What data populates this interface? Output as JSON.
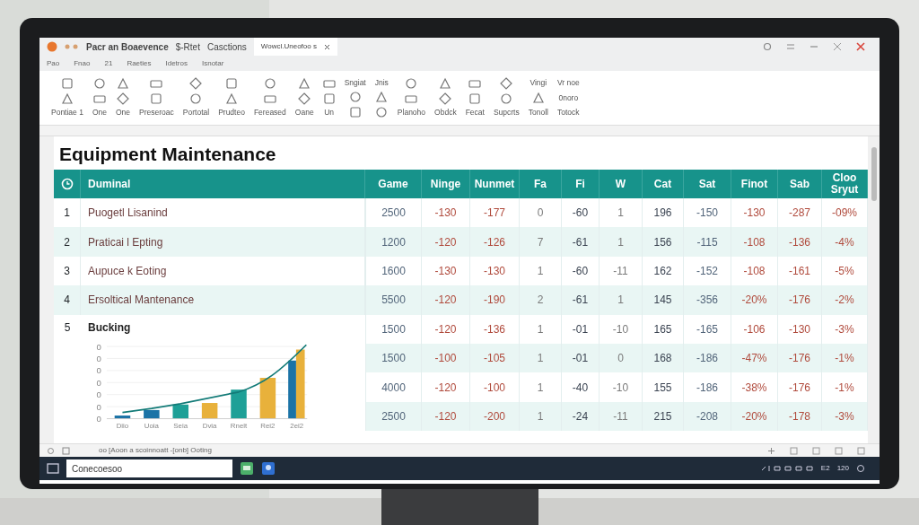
{
  "window": {
    "title": "Pacr an Boaevence",
    "title_extras": [
      "$-Rtet",
      "Casctions"
    ],
    "tab": {
      "label": "Wowcl.Uneofoo s",
      "selected": true
    }
  },
  "menu": [
    "Pao",
    "Fnao",
    "21",
    "Raeties",
    "Idetros",
    "Isnotar"
  ],
  "ribbon": [
    {
      "label": "Pontiae 1"
    },
    {
      "label": "One"
    },
    {
      "label": "One"
    },
    {
      "label": "Preseroac"
    },
    {
      "label": "Portotal"
    },
    {
      "label": "Prudteo"
    },
    {
      "label": "Fereased"
    },
    {
      "label": "Oane"
    },
    {
      "label": "Un"
    },
    {
      "top": "Sngiat"
    },
    {
      "top": "Jnis"
    },
    {
      "label": "Planoho"
    },
    {
      "label": "Obdck"
    },
    {
      "label": "Fecat"
    },
    {
      "label": "Supcrts"
    },
    {
      "top": "Vingi",
      "label": "Tonoll"
    },
    {
      "top": "Vr noe",
      "middle": "0noro",
      "label": "Totock"
    }
  ],
  "sheet": {
    "title": "Equipment Maintenance",
    "columns": [
      {
        "label": "Duminal"
      },
      {
        "label": "Game",
        "color": "#52657a"
      },
      {
        "label": "Ninge",
        "color": "#b04a3c"
      },
      {
        "label": "Nunmet",
        "color": "#b04a3c"
      },
      {
        "label": "Fa",
        "color": "#7a7a7a"
      },
      {
        "label": "Fi",
        "color": "#3b4452"
      },
      {
        "label": "W",
        "color": "#7a7a7a"
      },
      {
        "label": "Cat",
        "color": "#3b4452"
      },
      {
        "label": "Sat",
        "color": "#52657a"
      },
      {
        "label": "Finot",
        "color": "#b04a3c"
      },
      {
        "label": "Sab",
        "color": "#b04a3c"
      },
      {
        "label": "Cloo Sryut",
        "color": "#b04a3c"
      }
    ],
    "rows": [
      {
        "number": "1",
        "name": "Puogetl Lisanind",
        "values": [
          "2500",
          "-130",
          "-177",
          "0",
          "-60",
          "1",
          "196",
          "-150",
          "-130",
          "-287",
          "-09%"
        ]
      },
      {
        "number": "2",
        "name": "Praticai l Epting",
        "values": [
          "1200",
          "-120",
          "-126",
          "7",
          "-61",
          "1",
          "156",
          "-115",
          "-108",
          "-136",
          "-4%"
        ]
      },
      {
        "number": "3",
        "name": "Aupuce k Eoting",
        "values": [
          "1600",
          "-130",
          "-130",
          "1",
          "-60",
          "-11",
          "162",
          "-152",
          "-108",
          "-161",
          "-5%"
        ]
      },
      {
        "number": "4",
        "name": "Ersoltical Mantenance",
        "values": [
          "5500",
          "-120",
          "-190",
          "2",
          "-61",
          "1",
          "145",
          "-356",
          "-20%",
          "-176",
          "-2%"
        ]
      },
      {
        "number": "5",
        "name": "Bucking",
        "values": [
          "1500",
          "-120",
          "-136",
          "1",
          "-01",
          "-10",
          "165",
          "-165",
          "-106",
          "-130",
          "-3%"
        ]
      },
      {
        "values": [
          "1500",
          "-100",
          "-105",
          "1",
          "-01",
          "0",
          "168",
          "-186",
          "-47%",
          "-176",
          "-1%"
        ]
      },
      {
        "values": [
          "4000",
          "-120",
          "-100",
          "1",
          "-40",
          "-10",
          "155",
          "-186",
          "-38%",
          "-176",
          "-1%"
        ]
      },
      {
        "values": [
          "2500",
          "-120",
          "-200",
          "1",
          "-24",
          "-11",
          "215",
          "-208",
          "-20%",
          "-178",
          "-3%"
        ]
      }
    ],
    "chart": {
      "y_labels": [
        "0",
        "0",
        "0",
        "0",
        "0",
        "0",
        "0"
      ],
      "x_labels": [
        "Diio",
        "Uoia",
        "Seia",
        "Dvia",
        "Rnelt",
        "Rei2",
        "2ei2"
      ]
    }
  },
  "status_bar": {
    "text": "oo [Aoon a scoinnoatt -[onb] Ooting"
  },
  "taskbar": {
    "search": "Conecoesoo",
    "tray": [
      "E2",
      "120"
    ]
  }
}
